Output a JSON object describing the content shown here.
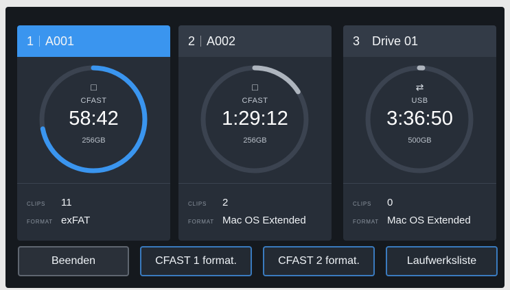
{
  "cards": [
    {
      "slot": "1",
      "name": "A001",
      "media_type": "CFAST",
      "icon": "cfast-card-icon",
      "time": "58:42",
      "capacity": "256GB",
      "clips_label": "CLIPS",
      "clips": "11",
      "format_label": "FORMAT",
      "format": "exFAT",
      "usage": 0.72,
      "selected": true
    },
    {
      "slot": "2",
      "name": "A002",
      "media_type": "CFAST",
      "icon": "cfast-card-icon",
      "time": "1:29:12",
      "capacity": "256GB",
      "clips_label": "CLIPS",
      "clips": "2",
      "format_label": "FORMAT",
      "format": "Mac OS Extended",
      "usage": 0.16,
      "selected": false
    },
    {
      "slot": "3",
      "name": "Drive 01",
      "media_type": "USB",
      "icon": "usb-icon",
      "time": "3:36:50",
      "capacity": "500GB",
      "clips_label": "CLIPS",
      "clips": "0",
      "format_label": "FORMAT",
      "format": "Mac OS Extended",
      "usage": 0.01,
      "selected": false
    }
  ],
  "buttons": {
    "quit": "Beenden",
    "format_cfast1": "CFAST 1 format.",
    "format_cfast2": "CFAST 2 format.",
    "drive_list": "Laufwerksliste"
  },
  "colors": {
    "accent": "#3a95ef",
    "arc_selected": "#3a95ef",
    "arc_default": "#aeb5be",
    "ring_track": "#3b4350"
  }
}
